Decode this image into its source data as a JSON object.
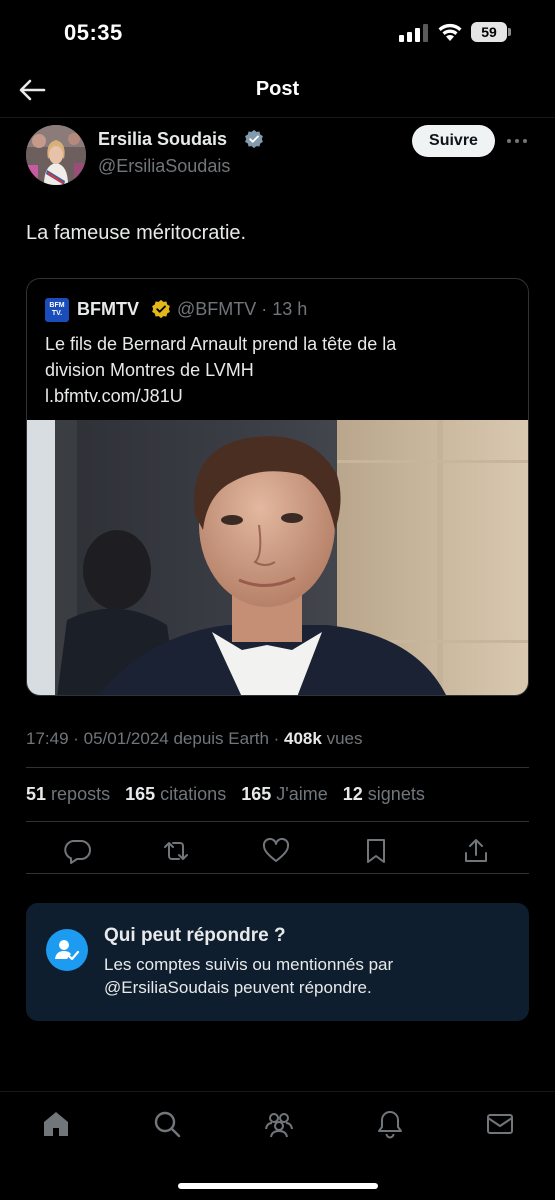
{
  "status_bar": {
    "time": "05:35",
    "battery": "59"
  },
  "header": {
    "title": "Post"
  },
  "author": {
    "name": "Ersilia Soudais",
    "handle": "@ErsiliaSoudais",
    "follow_label": "Suivre"
  },
  "post": {
    "text": "La fameuse méritocratie."
  },
  "quote": {
    "logo_text": "BFM TV.",
    "name": "BFMTV",
    "handle_time": "@BFMTV · 13 h",
    "text_lines": [
      "Le fils de Bernard Arnault prend la tête de la",
      "division Montres de LVMH",
      "l.bfmtv.com/J81U"
    ]
  },
  "meta": {
    "timestamp": "17:49 · 05/01/2024 depuis Earth · ",
    "views_count": "408k",
    "views_label": " vues"
  },
  "stats": [
    {
      "count": "51",
      "label": "reposts"
    },
    {
      "count": "165",
      "label": "citations"
    },
    {
      "count": "165",
      "label": "J'aime"
    },
    {
      "count": "12",
      "label": "signets"
    }
  ],
  "reply_info": {
    "title": "Qui peut répondre ?",
    "desc_lines": [
      "Les comptes suivis ou mentionnés par",
      "@ErsiliaSoudais peuvent répondre."
    ]
  },
  "icons": {
    "back": "arrow-left-icon",
    "verified": "verified-badge-icon",
    "more": "more-dots-icon",
    "reply": "reply-icon",
    "repost": "repost-icon",
    "like": "heart-icon",
    "bookmark": "bookmark-icon",
    "share": "share-icon",
    "home": "home-icon",
    "search": "search-icon",
    "communities": "communities-icon",
    "notifications": "bell-icon",
    "messages": "mail-icon"
  },
  "colors": {
    "accent": "#1d9bf0",
    "secondary_text": "#71767b",
    "gold_badge": "#e2b719",
    "gray_badge": "#829aab"
  }
}
